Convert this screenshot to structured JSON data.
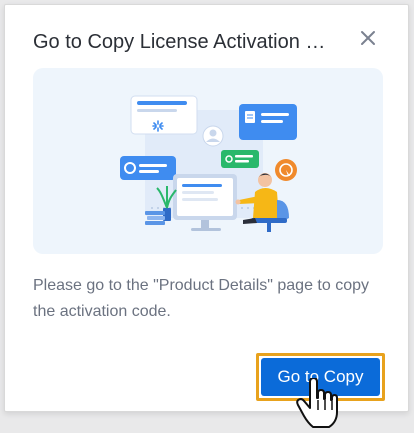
{
  "dialog": {
    "title": "Go to Copy License Activation …",
    "close_icon": "close-icon",
    "description": "Please go to the \"Product Details\" page to copy the activation code.",
    "primary_button_label": "Go to Copy",
    "colors": {
      "accent": "#0b6bd9",
      "focus_ring": "#e8a21d",
      "illustration_bg": "#eef5fc",
      "title_text": "#2b2f36",
      "body_text": "#6b7280"
    }
  },
  "cursor": {
    "icon": "hand-pointer-icon"
  }
}
